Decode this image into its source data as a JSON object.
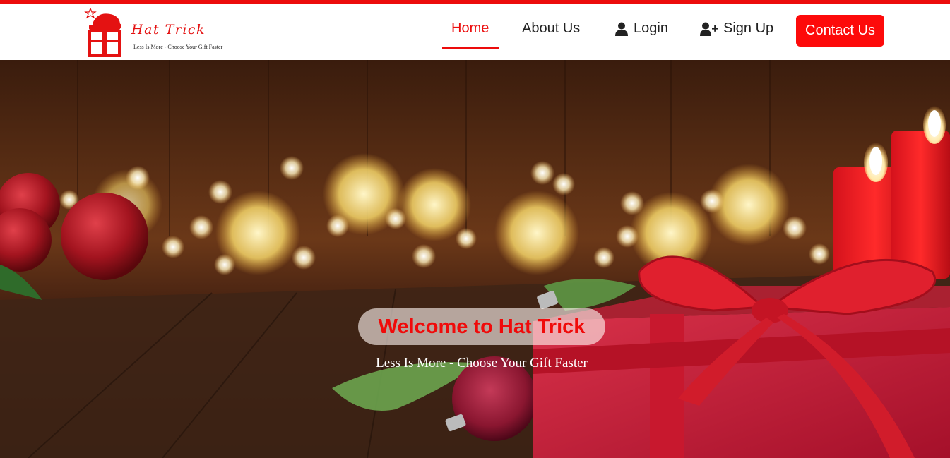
{
  "brand": {
    "name": "Hat Trick",
    "tagline": "Less Is More - Choose Your Gift Faster",
    "logo_icon": "santa-hat-gift-icon"
  },
  "nav": {
    "items": [
      {
        "label": "Home",
        "active": true
      },
      {
        "label": "About Us",
        "active": false
      },
      {
        "label": "Login",
        "icon": "user-icon",
        "active": false
      },
      {
        "label": "Sign Up",
        "icon": "user-plus-icon",
        "active": false
      }
    ],
    "contact_label": "Contact Us"
  },
  "hero": {
    "title": "Welcome to Hat Trick",
    "subtitle": "Less Is More - Choose Your Gift Faster",
    "image": "christmas-gifts-background"
  },
  "colors": {
    "accent": "#ec0c0c",
    "button": "#fd0a0a",
    "text": "#222222"
  }
}
